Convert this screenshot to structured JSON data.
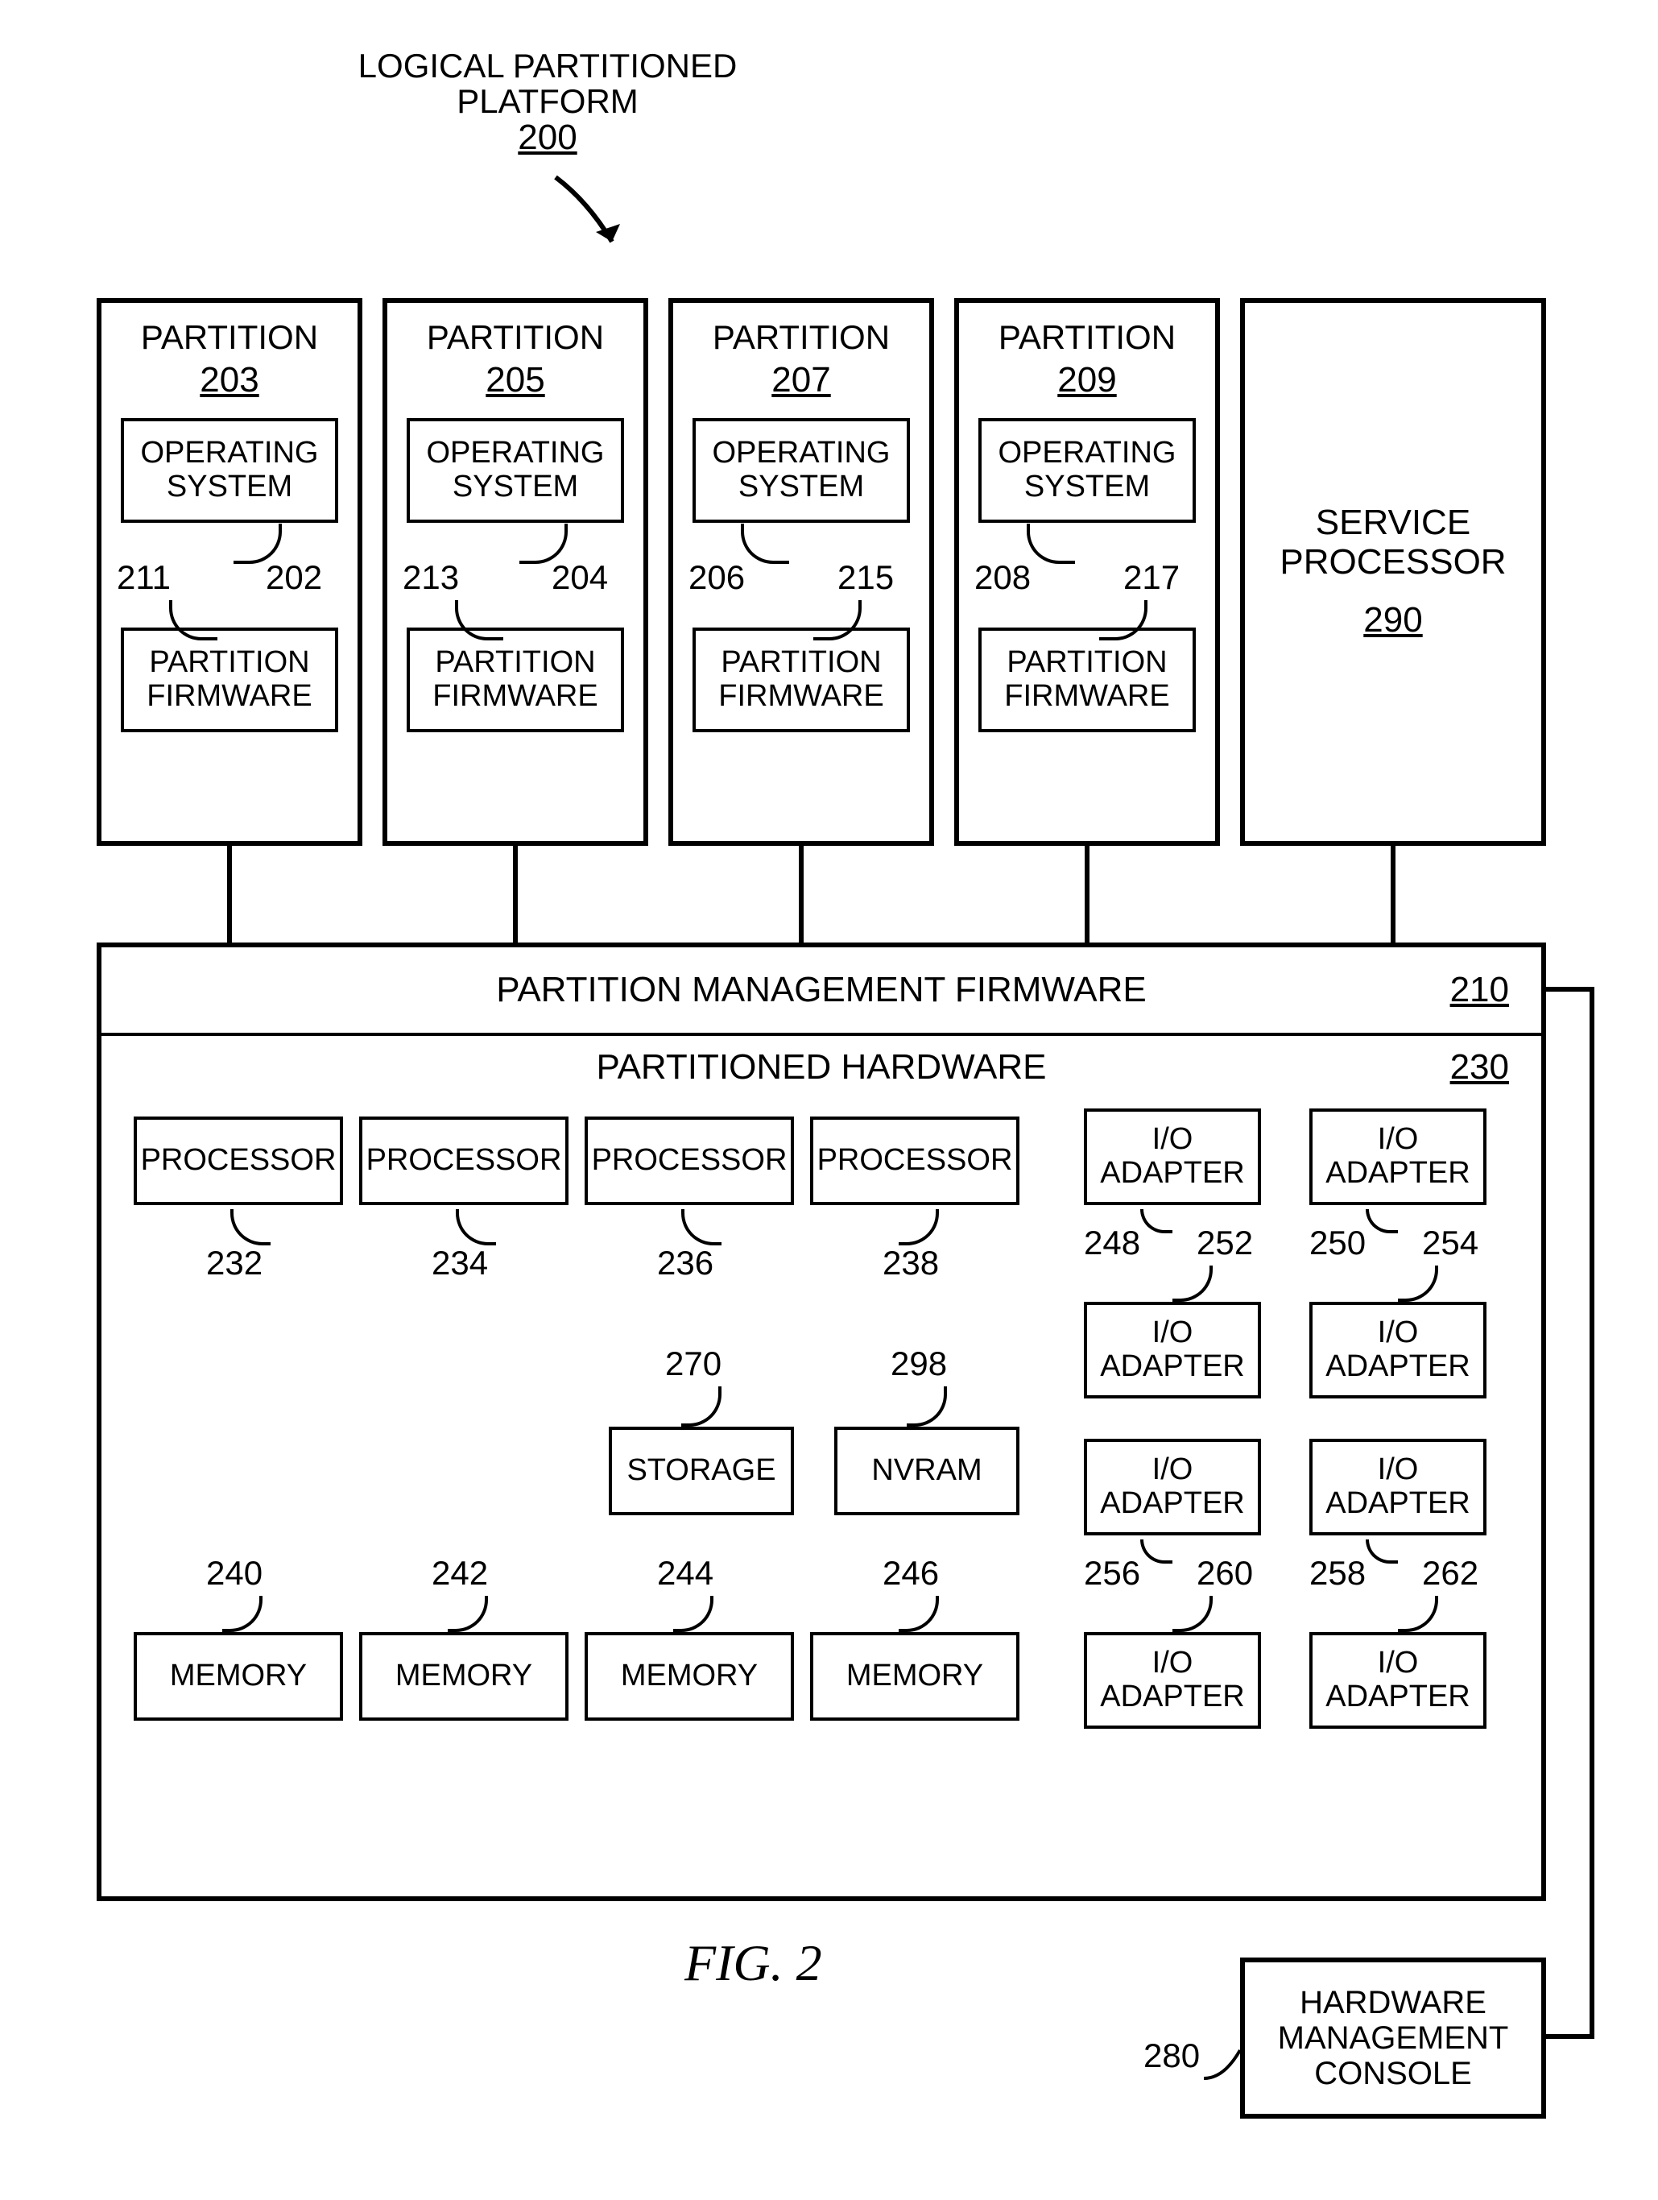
{
  "title_top": {
    "line1": "LOGICAL PARTITIONED",
    "line2": "PLATFORM",
    "num": "200"
  },
  "partitions": [
    {
      "title": "PARTITION",
      "num": "203",
      "os": "OPERATING\nSYSTEM",
      "os_num": "202",
      "fw": "PARTITION\nFIRMWARE",
      "fw_num": "211"
    },
    {
      "title": "PARTITION",
      "num": "205",
      "os": "OPERATING\nSYSTEM",
      "os_num": "204",
      "fw": "PARTITION\nFIRMWARE",
      "fw_num": "213"
    },
    {
      "title": "PARTITION",
      "num": "207",
      "os": "OPERATING\nSYSTEM",
      "os_num": "206",
      "fw": "PARTITION\nFIRMWARE",
      "fw_num": "215"
    },
    {
      "title": "PARTITION",
      "num": "209",
      "os": "OPERATING\nSYSTEM",
      "os_num": "208",
      "fw": "PARTITION\nFIRMWARE",
      "fw_num": "217"
    }
  ],
  "service_processor": {
    "title": "SERVICE\nPROCESSOR",
    "num": "290"
  },
  "pmf": {
    "title": "PARTITION MANAGEMENT FIRMWARE",
    "num": "210"
  },
  "ph": {
    "title": "PARTITIONED HARDWARE",
    "num": "230"
  },
  "hw": {
    "processor": "PROCESSOR",
    "io_adapter": "I/O\nADAPTER",
    "memory": "MEMORY",
    "storage": "STORAGE",
    "nvram": "NVRAM",
    "nums": {
      "proc": [
        "232",
        "234",
        "236",
        "238"
      ],
      "io_row1": [
        "248",
        "250"
      ],
      "io_row1b": [
        "252",
        "254"
      ],
      "io_row3": [
        "256",
        "258"
      ],
      "io_row3b": [
        "260",
        "262"
      ],
      "storage": "270",
      "nvram": "298",
      "mem": [
        "240",
        "242",
        "244",
        "246"
      ]
    }
  },
  "hmc": {
    "title": "HARDWARE\nMANAGEMENT\nCONSOLE",
    "num": "280"
  },
  "fig": "FIG. 2"
}
